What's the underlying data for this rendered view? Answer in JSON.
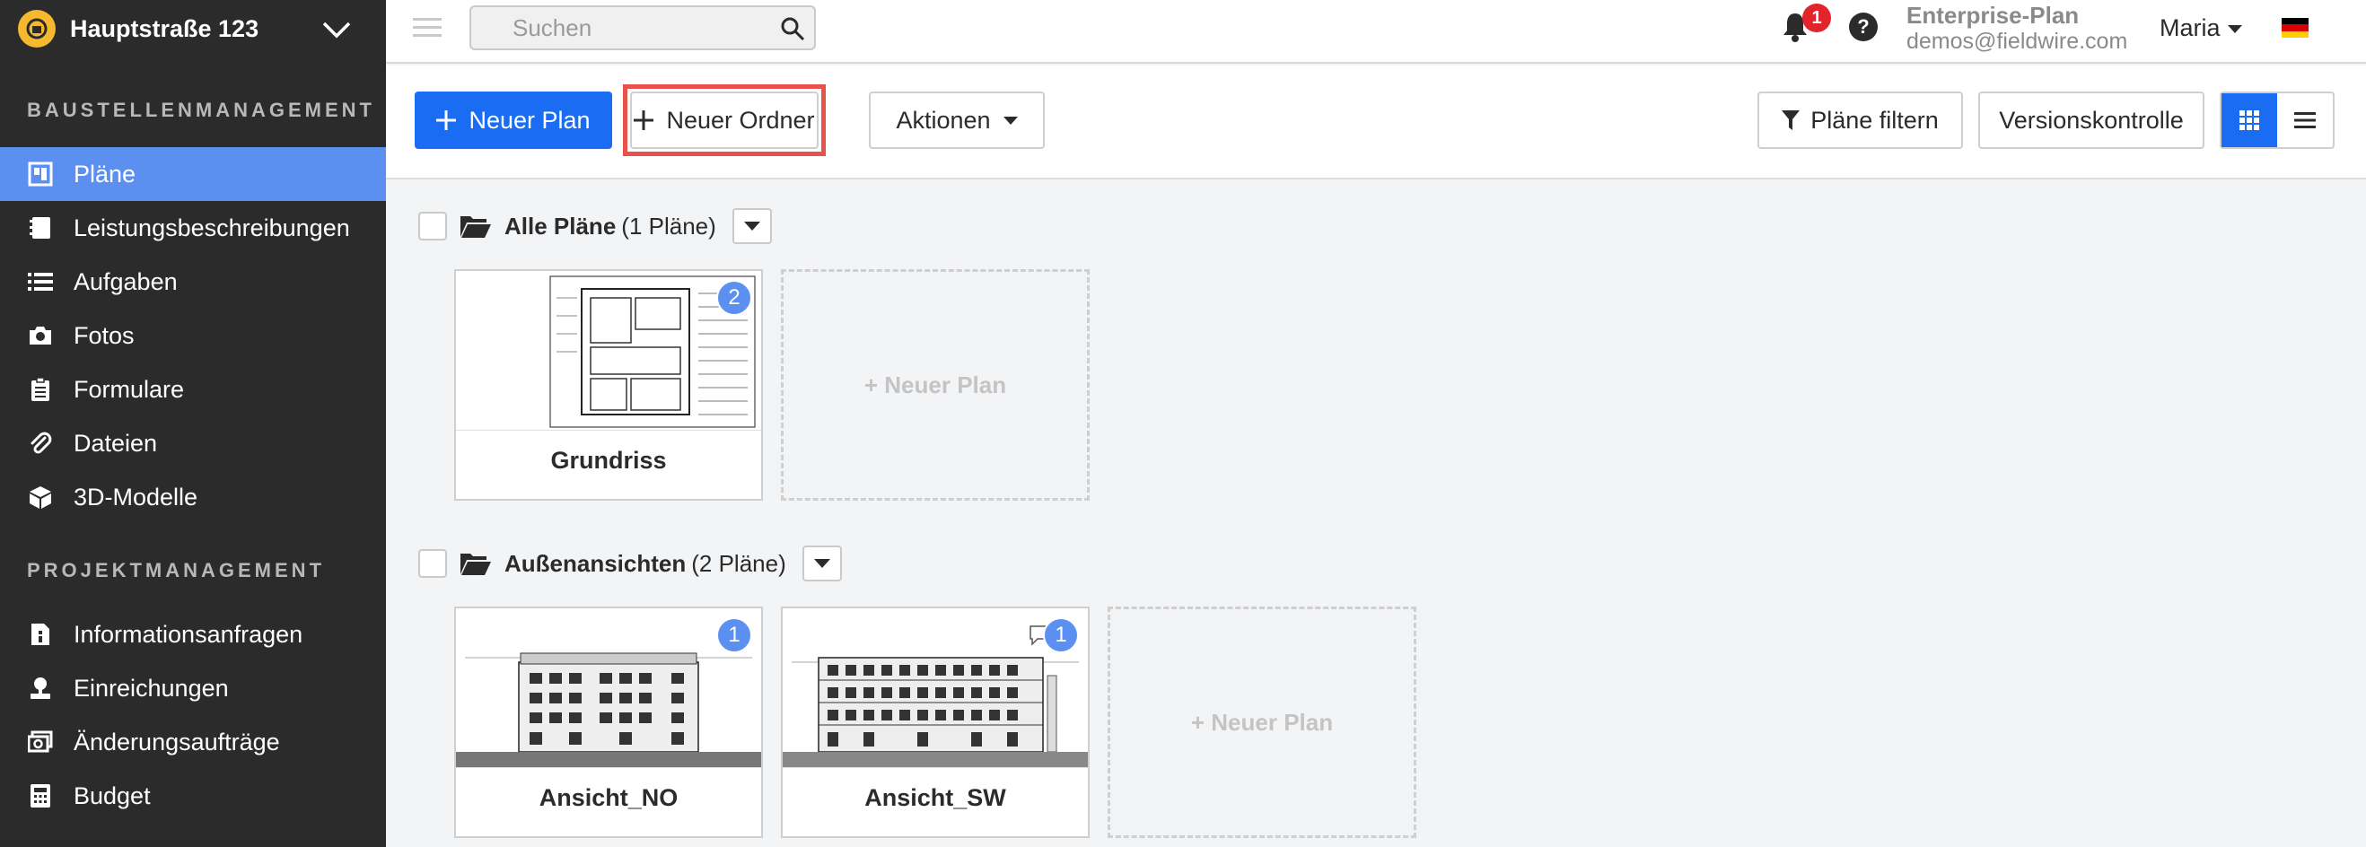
{
  "project": {
    "name": "Hauptstraße 123"
  },
  "sidebar": {
    "section1_title": "BAUSTELLENMANAGEMENT",
    "section2_title": "PROJEKTMANAGEMENT",
    "items": [
      {
        "label": "Pläne",
        "icon": "plans-icon",
        "active": true
      },
      {
        "label": "Leistungsbeschreibungen",
        "icon": "specs-icon"
      },
      {
        "label": "Aufgaben",
        "icon": "tasks-icon"
      },
      {
        "label": "Fotos",
        "icon": "camera-icon"
      },
      {
        "label": "Formulare",
        "icon": "forms-icon"
      },
      {
        "label": "Dateien",
        "icon": "paperclip-icon"
      },
      {
        "label": "3D-Modelle",
        "icon": "cube-icon"
      },
      {
        "label": "Informationsanfragen",
        "icon": "rfi-icon"
      },
      {
        "label": "Einreichungen",
        "icon": "submittal-icon"
      },
      {
        "label": "Änderungsaufträge",
        "icon": "change-order-icon"
      },
      {
        "label": "Budget",
        "icon": "calculator-icon"
      }
    ]
  },
  "topbar": {
    "search_placeholder": "Suchen",
    "notification_count": "1",
    "help_label": "?",
    "plan_name": "Enterprise-Plan",
    "email": "demos@fieldwire.com",
    "user_name": "Maria"
  },
  "toolbar": {
    "new_plan": "Neuer Plan",
    "new_folder": "Neuer Ordner",
    "actions": "Aktionen",
    "filter": "Pläne filtern",
    "version_control": "Versionskontrolle"
  },
  "folders": [
    {
      "name": "Alle Pläne",
      "count": "(1 Pläne)",
      "plans": [
        {
          "name": "Grundriss",
          "badge": "2"
        }
      ],
      "new_plan_label": "+ Neuer Plan"
    },
    {
      "name": "Außenansichten",
      "count": "(2 Pläne)",
      "plans": [
        {
          "name": "Ansicht_NO",
          "badge": "1"
        },
        {
          "name": "Ansicht_SW",
          "badge": "1"
        }
      ],
      "new_plan_label": "+ Neuer Plan"
    }
  ],
  "colors": {
    "primary": "#1a6cf2",
    "sidebar_bg": "#2b2b2b",
    "active_nav": "#5b8ff0",
    "highlight": "#e7524a",
    "badge": "#e3242b"
  }
}
